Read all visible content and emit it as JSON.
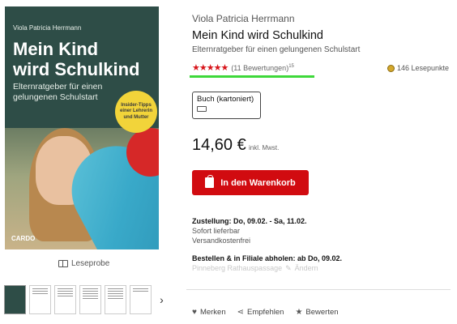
{
  "cover": {
    "author": "Viola Patricia Herrmann",
    "title_line1": "Mein Kind",
    "title_line2": "wird Schulkind",
    "subtitle_line1": "Elternratgeber für einen",
    "subtitle_line2": "gelungenen Schulstart",
    "badge": "Insider-Tipps einer Lehrerin und Mutter",
    "publisher": "CARDO",
    "background_color": "#2e4d47"
  },
  "leseprobe_label": "Leseprobe",
  "product": {
    "author": "Viola Patricia Herrmann",
    "title": "Mein Kind wird Schulkind",
    "subtitle": "Elternratgeber für einen gelungenen Schulstart",
    "rating": {
      "stars": "★★★★★",
      "value": 4.5,
      "reviews": "(11 Bewertungen)",
      "footnote": "15"
    },
    "points": "146 Lesepunkte",
    "format": "Buch (kartoniert)",
    "price": "14,60 €",
    "tax": "inkl. Mwst.",
    "cart_button": "In den Warenkorb",
    "delivery": {
      "line1": "Zustellung: Do, 09.02. - Sa, 11.02.",
      "line2": "Sofort lieferbar",
      "line3": "Versandkostenfrei"
    },
    "pickup": "Bestellen & in Filiale abholen: ab Do, 09.02.",
    "store": "Pinneberg Rathauspassage",
    "store_change": "Ändern",
    "actions": {
      "merken": "Merken",
      "empfehlen": "Empfehlen",
      "bewerten": "Bewerten"
    }
  },
  "colors": {
    "accent": "#d10b10",
    "highlight": "#3ed83a"
  }
}
